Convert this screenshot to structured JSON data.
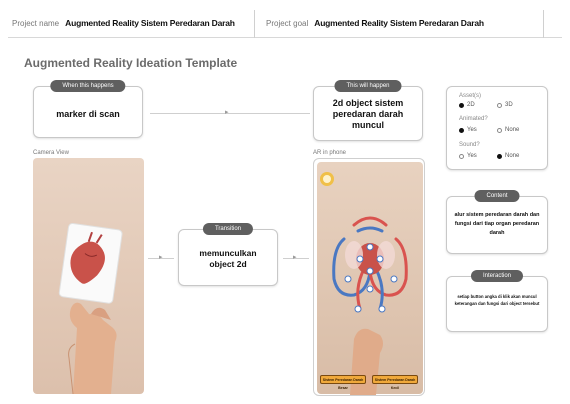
{
  "header": {
    "project_name_label": "Project name",
    "project_name_value": "Augmented Reality Sistem Peredaran Darah",
    "project_goal_label": "Project goal",
    "project_goal_value": "Augmented Reality Sistem Peredaran Darah"
  },
  "template_title": "Augmented Reality Ideation Template",
  "when": {
    "pill": "When this happens",
    "text": "marker di scan"
  },
  "will": {
    "pill": "This will happen",
    "text": "2d object sistem peredaran darah muncul"
  },
  "transition": {
    "pill": "Transition",
    "text": "memunculkan object 2d"
  },
  "camera_caption": "Camera View",
  "phone_caption": "AR in phone",
  "options": {
    "assets_label": "Asset(s)",
    "assets": [
      {
        "label": "2D",
        "selected": true
      },
      {
        "label": "3D",
        "selected": false
      }
    ],
    "animated_label": "Animated?",
    "animated": [
      {
        "label": "Yes",
        "selected": true
      },
      {
        "label": "None",
        "selected": false
      }
    ],
    "sound_label": "Sound?",
    "sound": [
      {
        "label": "Yes",
        "selected": false
      },
      {
        "label": "None",
        "selected": true
      }
    ]
  },
  "content": {
    "pill": "Content",
    "text": "alur sistem peredaran darah dan fungsi dari tiap organ peredaran darah"
  },
  "interaction": {
    "pill": "Interaction",
    "text": "setiap button angka di klik akan muncul keterangan dan fungsi dari object tersebut"
  },
  "ar_buttons": [
    "Sistem Peredaran Darah Besar",
    "Sistem Peredaran Darah Kecil"
  ],
  "colors": {
    "pill": "#5f5f5f",
    "artery": "#d9534f",
    "vein": "#4a78c2",
    "ar_button": "#f0a93b"
  }
}
